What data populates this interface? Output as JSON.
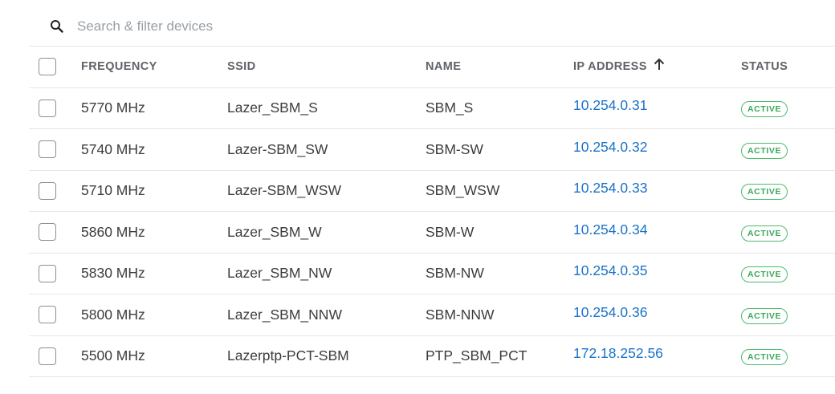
{
  "search": {
    "placeholder": "Search & filter devices",
    "value": ""
  },
  "table": {
    "headers": {
      "frequency": "FREQUENCY",
      "ssid": "SSID",
      "name": "NAME",
      "ip_address": "IP ADDRESS",
      "status": "STATUS"
    },
    "sort": {
      "column": "ip_address",
      "direction": "ascending",
      "icon": "arrow-up-icon"
    },
    "rows": [
      {
        "frequency": "5770 MHz",
        "ssid": "Lazer_SBM_S",
        "name": "SBM_S",
        "ip": "10.254.0.31",
        "status": "ACTIVE"
      },
      {
        "frequency": "5740 MHz",
        "ssid": "Lazer-SBM_SW",
        "name": "SBM-SW",
        "ip": "10.254.0.32",
        "status": "ACTIVE"
      },
      {
        "frequency": "5710 MHz",
        "ssid": "Lazer-SBM_WSW",
        "name": "SBM_WSW",
        "ip": "10.254.0.33",
        "status": "ACTIVE"
      },
      {
        "frequency": "5860 MHz",
        "ssid": "Lazer_SBM_W",
        "name": "SBM-W",
        "ip": "10.254.0.34",
        "status": "ACTIVE"
      },
      {
        "frequency": "5830 MHz",
        "ssid": "Lazer_SBM_NW",
        "name": "SBM-NW",
        "ip": "10.254.0.35",
        "status": "ACTIVE"
      },
      {
        "frequency": "5800 MHz",
        "ssid": "Lazer_SBM_NNW",
        "name": "SBM-NNW",
        "ip": "10.254.0.36",
        "status": "ACTIVE"
      },
      {
        "frequency": "5500 MHz",
        "ssid": "Lazerptp-PCT-SBM",
        "name": "PTP_SBM_PCT",
        "ip": "172.18.252.56",
        "status": "ACTIVE"
      }
    ]
  },
  "colors": {
    "link": "#1a73c8",
    "active_badge": "#3aa95a",
    "divider": "#e6e6e6"
  }
}
